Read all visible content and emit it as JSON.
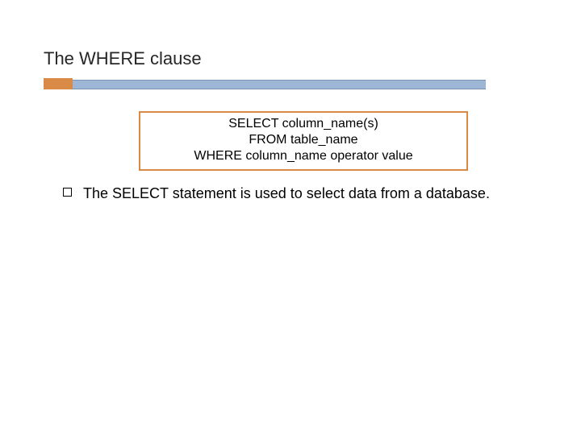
{
  "slide": {
    "title": "The WHERE clause",
    "accent_color": "#d88a46",
    "bar_color": "#9db6d6"
  },
  "code_box": {
    "line1": "SELECT column_name(s)",
    "line2": "FROM table_name",
    "line3": "WHERE column_name operator value"
  },
  "body": {
    "items": [
      {
        "text": "The SELECT statement is used to select data from a database."
      }
    ]
  }
}
